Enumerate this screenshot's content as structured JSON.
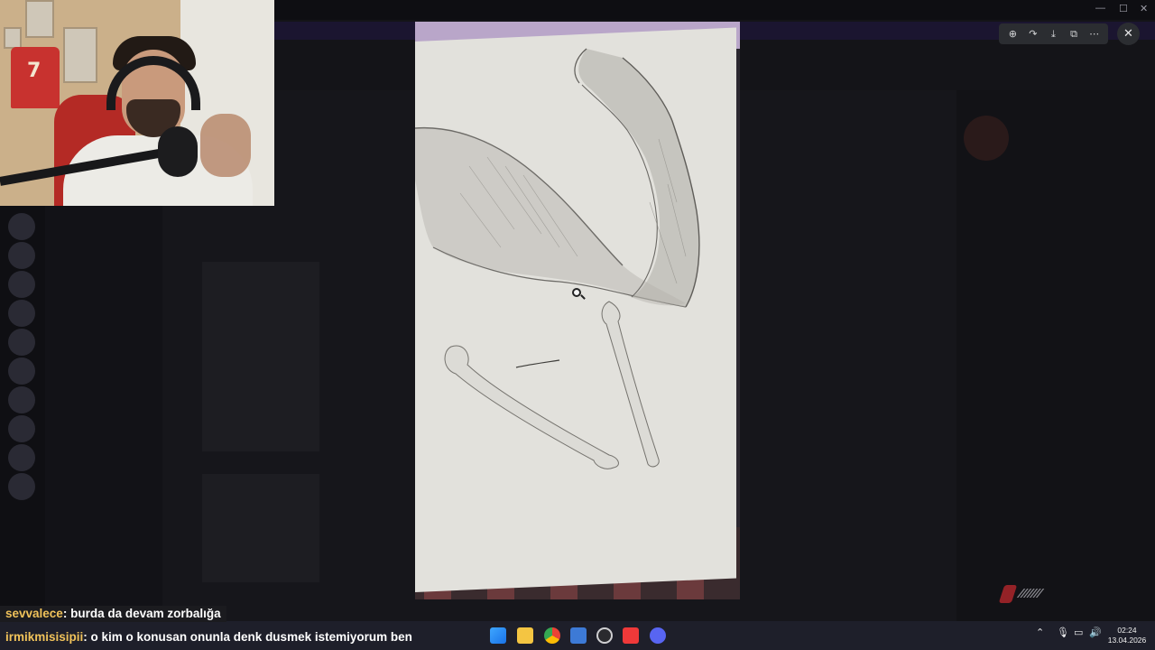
{
  "chat": {
    "line1": {
      "user": "sevvalece",
      "message": ": burda da devam zorbalığa"
    },
    "line2": {
      "user": "irmikmisisipii",
      "message": ": o kim o konusan onunla denk dusmek istemiyorum ben"
    }
  },
  "viewer": {
    "toolbar": [
      "zoom-in-icon",
      "forward-icon",
      "download-icon",
      "open-external-icon",
      "more-icon"
    ],
    "close_label": "✕"
  },
  "webcam": {
    "jersey_number": "7"
  },
  "taskbar": {
    "time": "02:24",
    "date": "13.04.2026",
    "apps": [
      "windows-start-icon",
      "file-explorer-icon",
      "chrome-icon",
      "app-icon",
      "obs-icon",
      "vivaldi-icon",
      "discord-icon"
    ]
  },
  "colors": {
    "chat_username": "#f0c25a",
    "chat_bg": "#1b1b1f",
    "taskbar_bg": "#1e1f2a",
    "viewer_button_bg": "#2b2d31"
  }
}
